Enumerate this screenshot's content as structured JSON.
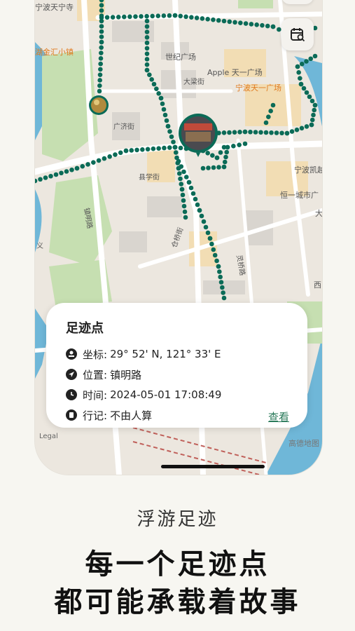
{
  "map": {
    "labels": {
      "temple": "宁波天宁寺",
      "hujin": "湖金汇小镇",
      "century": "世纪广场",
      "apple": "Apple 天一广场",
      "tianyi": "宁波天一广场",
      "dayue": "大梁街",
      "kaiyue": "宁波凯越",
      "hengyi": "恒一城市广",
      "zhenming": "镇明路",
      "cangqiao": "仓桥街",
      "xiangyuan": "县学街",
      "guangji": "广济街",
      "xi": "西",
      "da": "大",
      "yu": "义",
      "lingqiao": "灵桥路",
      "legal": "Legal",
      "gaode": "高德地图"
    },
    "colors": {
      "track": "#0b6b57",
      "water": "#6fb7d8",
      "park": "#c6dfb1",
      "road": "#ffffff"
    }
  },
  "card": {
    "title": "足迹点",
    "rows": [
      {
        "icon": "coordinate-icon",
        "key": "坐标:",
        "value": "29° 52' N, 121° 33' E"
      },
      {
        "icon": "location-arrow-icon",
        "key": "位置:",
        "value": "镇明路"
      },
      {
        "icon": "clock-icon",
        "key": "时间:",
        "value": "2024-05-01 17:08:49"
      },
      {
        "icon": "journal-icon",
        "key": "行记:",
        "value": "不由人算"
      }
    ],
    "view_link": "查看"
  },
  "footer": {
    "subtitle": "浮游足迹",
    "headline_line1": "每一个足迹点",
    "headline_line2": "都可能承载着故事"
  }
}
